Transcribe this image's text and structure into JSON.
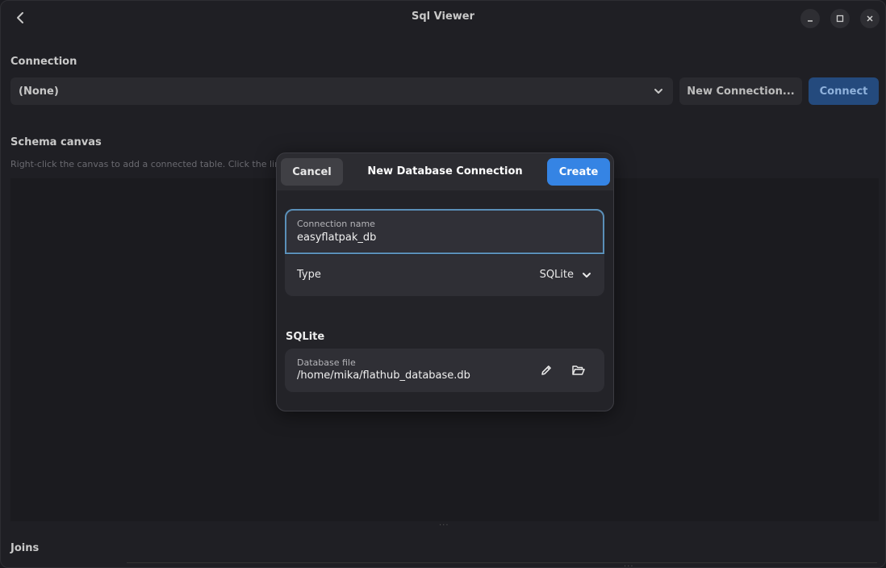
{
  "window": {
    "title": "Sql Viewer"
  },
  "connection": {
    "section_title": "Connection",
    "selected": "(None)",
    "new_connection_label": "New Connection...",
    "connect_label": "Connect"
  },
  "schema": {
    "section_title": "Schema canvas",
    "hint": "Right-click the canvas to add a connected table. Click the link icon o"
  },
  "joins": {
    "section_title": "Joins"
  },
  "dialog": {
    "title": "New Database Connection",
    "cancel_label": "Cancel",
    "create_label": "Create",
    "connection_name": {
      "label": "Connection name",
      "value": "easyflatpak_db"
    },
    "type": {
      "label": "Type",
      "value": "SQLite"
    },
    "sqlite_section_title": "SQLite",
    "database_file": {
      "label": "Database file",
      "value": "/home/mika/flathub_database.db"
    }
  },
  "icons": {
    "back": "chevron-left-icon",
    "minimize": "minimize-icon",
    "maximize": "maximize-icon",
    "close": "close-icon",
    "dropdown": "chevron-down-icon",
    "edit": "pencil-icon",
    "open_folder": "folder-open-icon"
  },
  "colors": {
    "accent": "#3584e4",
    "connect_button": "#244a7d",
    "focus_border": "#5a8fb8"
  }
}
